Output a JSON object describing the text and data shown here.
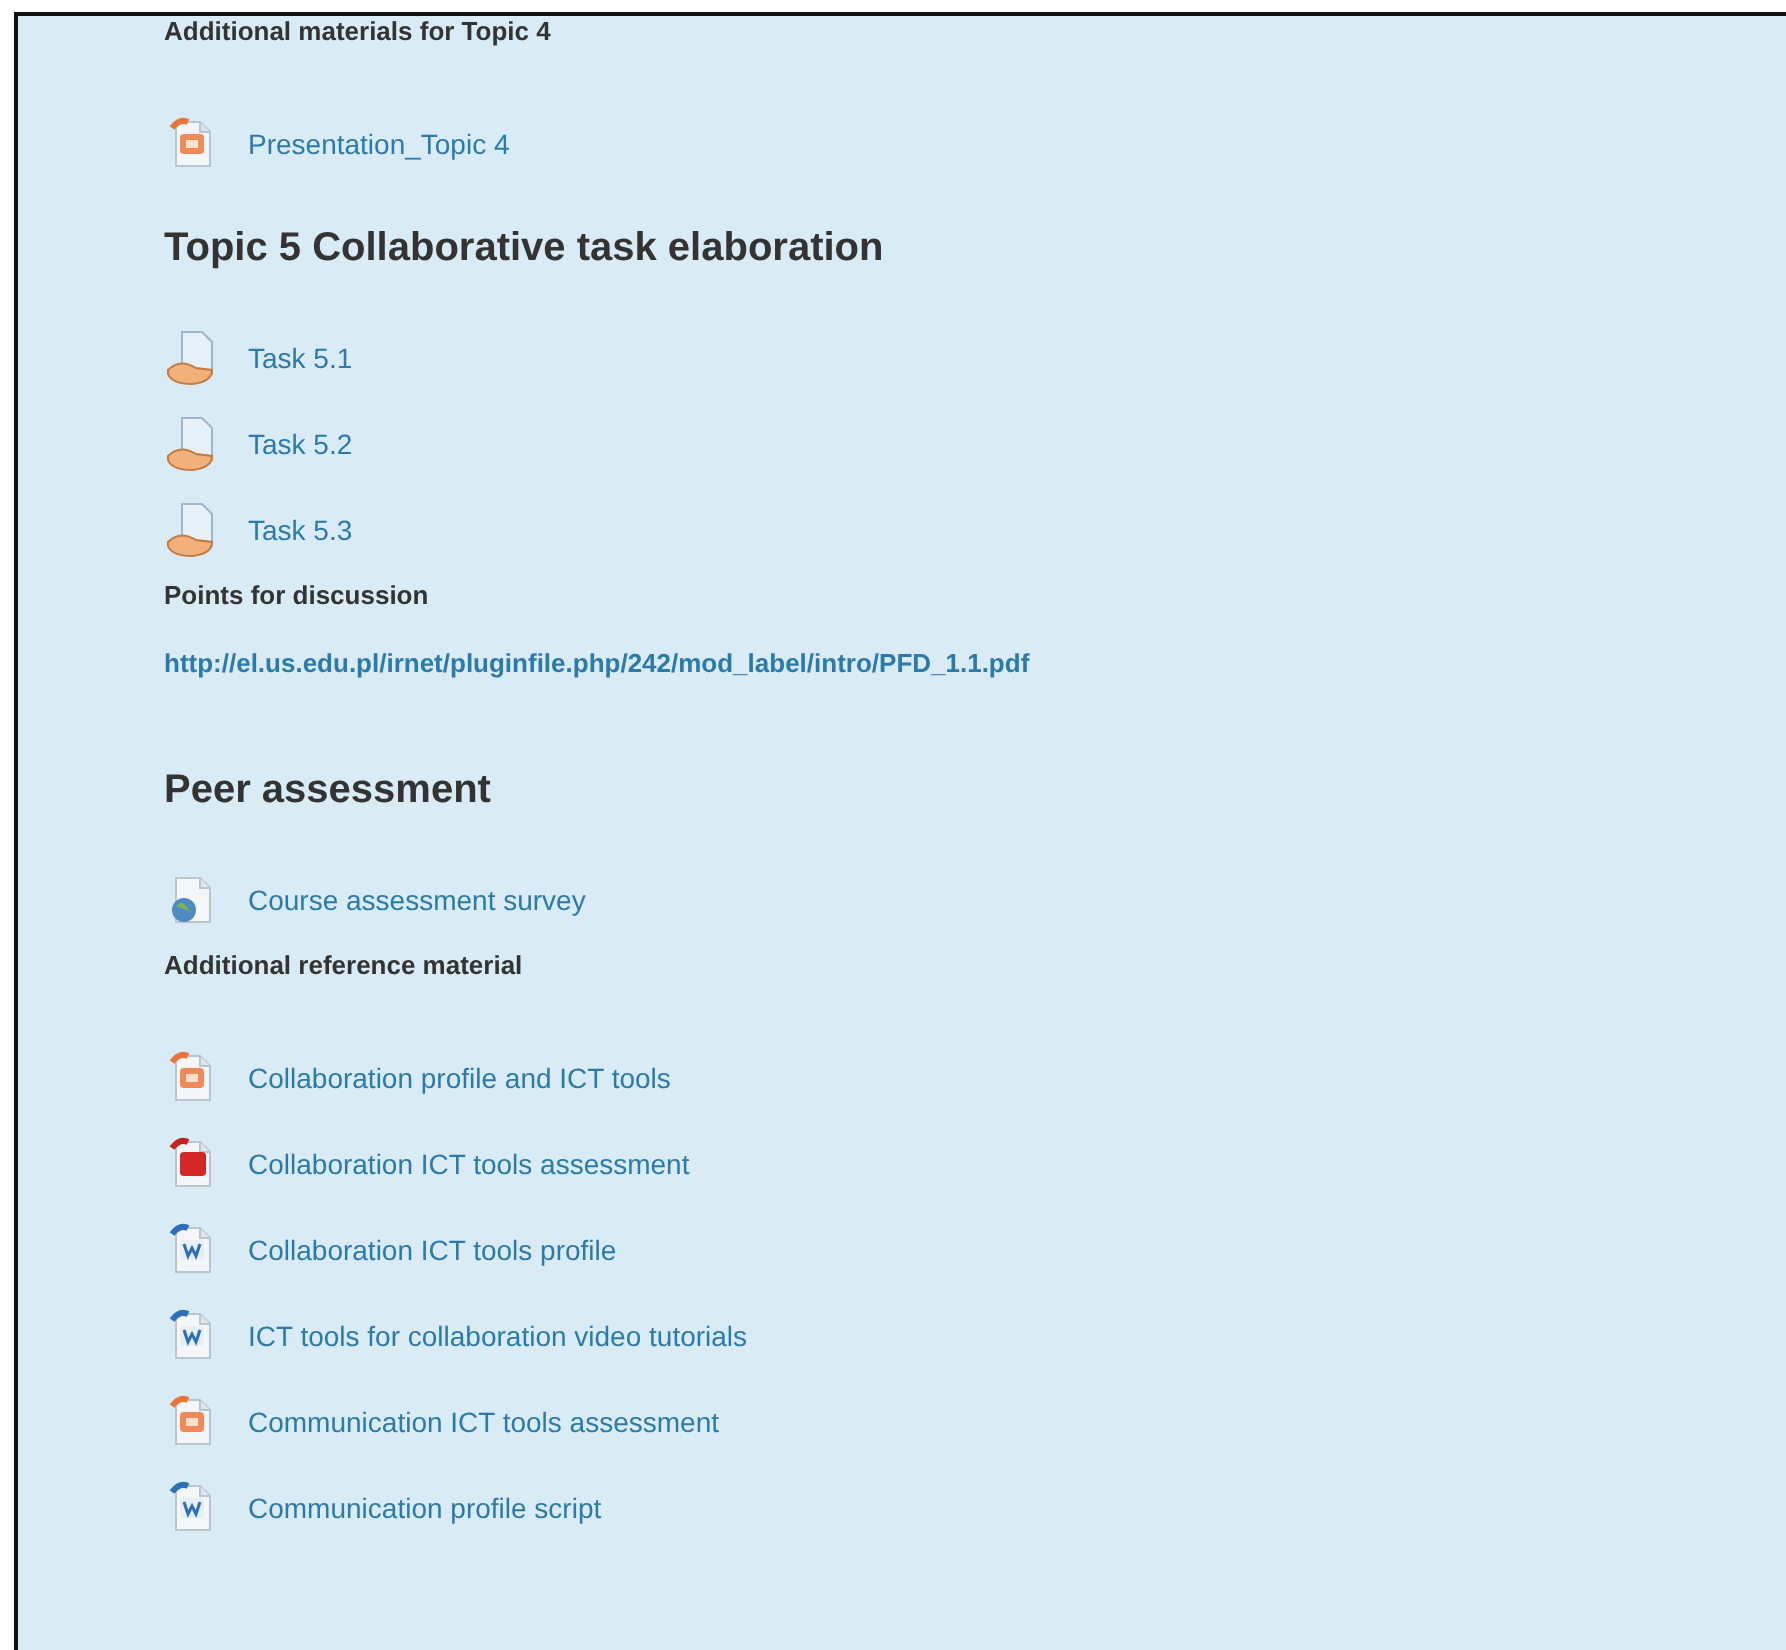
{
  "items": [
    {
      "kind": "label",
      "text": "Additional materials for Topic 4"
    },
    {
      "kind": "presentation",
      "text": "Presentation_Topic 4"
    },
    {
      "kind": "heading",
      "text": "Topic 5 Collaborative task elaboration"
    },
    {
      "kind": "assignment",
      "text": "Task 5.1"
    },
    {
      "kind": "assignment",
      "text": "Task 5.2"
    },
    {
      "kind": "assignment",
      "text": "Task 5.3"
    },
    {
      "kind": "label",
      "text": "Points for discussion"
    },
    {
      "kind": "url",
      "text": "http://el.us.edu.pl/irnet/pluginfile.php/242/mod_label/intro/PFD_1.1.pdf"
    },
    {
      "kind": "heading",
      "text": "Peer assessment"
    },
    {
      "kind": "survey",
      "text": "Course assessment survey"
    },
    {
      "kind": "label",
      "text": "Additional reference material"
    },
    {
      "kind": "presentation",
      "text": "Collaboration profile and ICT tools"
    },
    {
      "kind": "pdf",
      "text": "Collaboration ICT tools assessment"
    },
    {
      "kind": "document",
      "text": "Collaboration ICT tools profile"
    },
    {
      "kind": "document",
      "text": "ICT tools for collaboration video tutorials"
    },
    {
      "kind": "presentation",
      "text": "Communication ICT tools assessment"
    },
    {
      "kind": "document",
      "text": "Communication profile script"
    }
  ]
}
